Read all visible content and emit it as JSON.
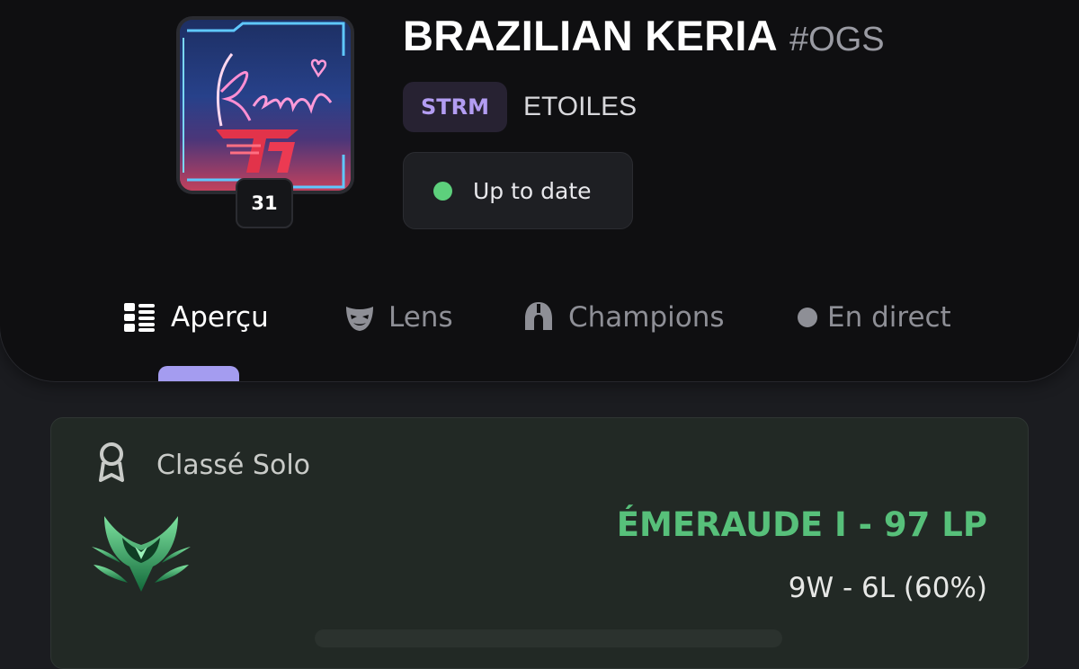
{
  "profile": {
    "name": "BRAZILIAN KERIA",
    "tag": "#OGS",
    "level": "31",
    "icon": "keria-t1-signature-icon"
  },
  "team": {
    "chip": "STRM",
    "name": "ETOILES"
  },
  "status": {
    "label": "Up to date",
    "color": "#5dd07c"
  },
  "tabs": [
    {
      "label": "Aperçu",
      "icon": "overview-grid-icon",
      "active": true
    },
    {
      "label": "Lens",
      "icon": "mask-icon",
      "active": false
    },
    {
      "label": "Champions",
      "icon": "helmet-icon",
      "active": false
    },
    {
      "label": "En direct",
      "icon": "live-dot-icon",
      "active": false
    }
  ],
  "ranked": {
    "queue": "Classé Solo",
    "queue_icon": "ribbon-award-icon",
    "emblem": "emerald-emblem-icon",
    "rank": "ÉMERAUDE I - 97 LP",
    "record": "9W - 6L (60%)",
    "rank_color": "#57c07a"
  },
  "colors": {
    "accent": "#a49cf0",
    "chip_text": "#b39df2",
    "background": "#1b1c20",
    "panel": "#0f0f11"
  }
}
